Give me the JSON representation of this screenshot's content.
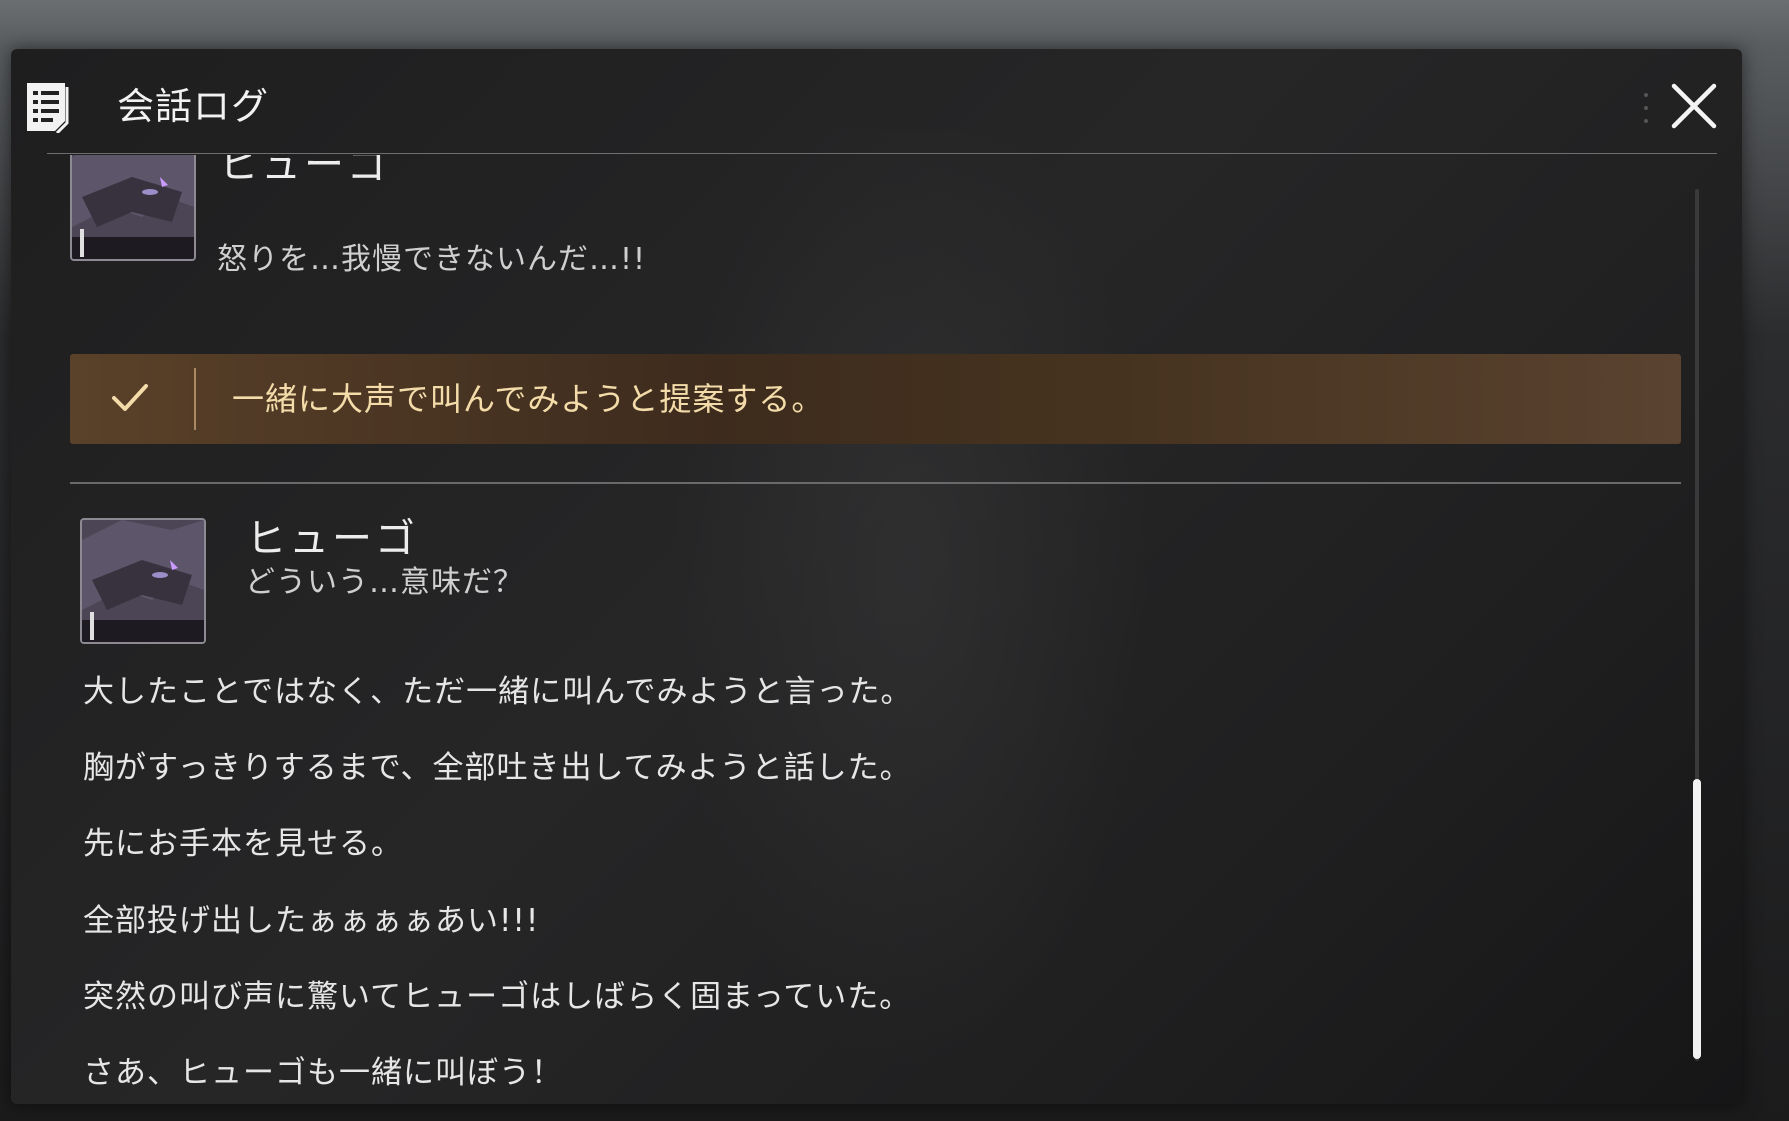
{
  "dialog": {
    "title": "会話ログ",
    "icons": {
      "header": "log-document-icon",
      "close": "close-icon",
      "menu": "vertical-dots-icon",
      "choice": "checkmark-icon"
    }
  },
  "entries": [
    {
      "speaker": "ヒューゴ",
      "line": "怒りを…我慢できないんだ…!!",
      "avatar": "hugo-portrait"
    },
    {
      "speaker": "ヒューゴ",
      "line": "どういう…意味だ？",
      "avatar": "hugo-portrait"
    }
  ],
  "choice": {
    "text": "一緒に大声で叫んでみようと提案する。",
    "selected": true
  },
  "narration": [
    "大したことではなく、ただ一緒に叫んでみようと言った。",
    "胸がすっきりするまで、全部吐き出してみようと話した。",
    "先にお手本を見せる。",
    "全部投げ出したぁぁぁぁあい!!!",
    "突然の叫び声に驚いてヒューゴはしばらく固まっていた。",
    "さあ、ヒューゴも一緒に叫ぼう！"
  ],
  "colors": {
    "accent": "#f3dca9",
    "choice_bg": "#4a3522",
    "panel_bg": "#232324"
  }
}
